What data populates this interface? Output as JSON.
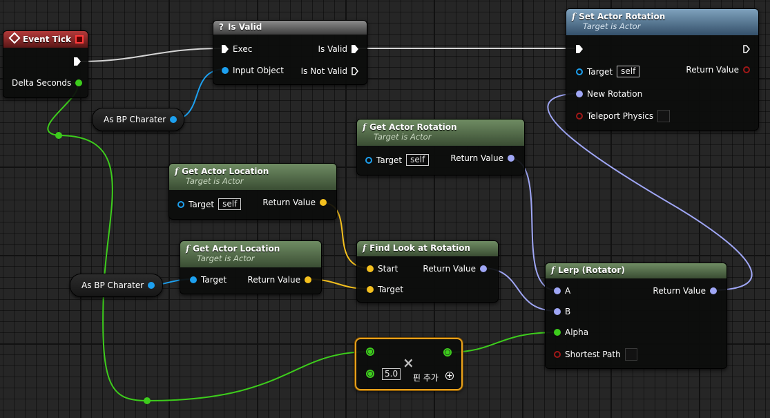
{
  "graph": {
    "event_tick": {
      "title": "Event Tick",
      "delta_label": "Delta Seconds"
    },
    "is_valid": {
      "title": "Is Valid",
      "exec": "Exec",
      "input": "Input Object",
      "valid": "Is Valid",
      "not_valid": "Is Not Valid"
    },
    "set_actor_rotation": {
      "title": "Set Actor Rotation",
      "subtitle": "Target is Actor",
      "target": "Target",
      "self": "self",
      "return": "Return Value",
      "new_rotation": "New Rotation",
      "teleport": "Teleport Physics"
    },
    "get_actor_rotation": {
      "title": "Get Actor Rotation",
      "subtitle": "Target is Actor",
      "target": "Target",
      "self": "self",
      "return": "Return Value"
    },
    "get_actor_location_1": {
      "title": "Get Actor Location",
      "subtitle": "Target is Actor",
      "target": "Target",
      "self": "self",
      "return": "Return Value"
    },
    "get_actor_location_2": {
      "title": "Get Actor Location",
      "subtitle": "Target is Actor",
      "target": "Target",
      "return": "Return Value"
    },
    "find_look_at": {
      "title": "Find Look at Rotation",
      "start": "Start",
      "target": "Target",
      "return": "Return Value"
    },
    "lerp": {
      "title": "Lerp (Rotator)",
      "a": "A",
      "b": "B",
      "alpha": "Alpha",
      "shortest": "Shortest Path",
      "return": "Return Value"
    },
    "multiply": {
      "value": "5.0",
      "add_pin": "핀 추가",
      "op_symbol": "×"
    },
    "cast_1": {
      "label": "As BP Charater"
    },
    "cast_2": {
      "label": "As BP Charater"
    }
  },
  "colors": {
    "exec": "#ffffff",
    "object": "#1da0ef",
    "vector": "#f4c01e",
    "rotator": "#9fa6f5",
    "float": "#3dcd1c",
    "bool": "#a01818",
    "selection": "#e8a11c"
  }
}
